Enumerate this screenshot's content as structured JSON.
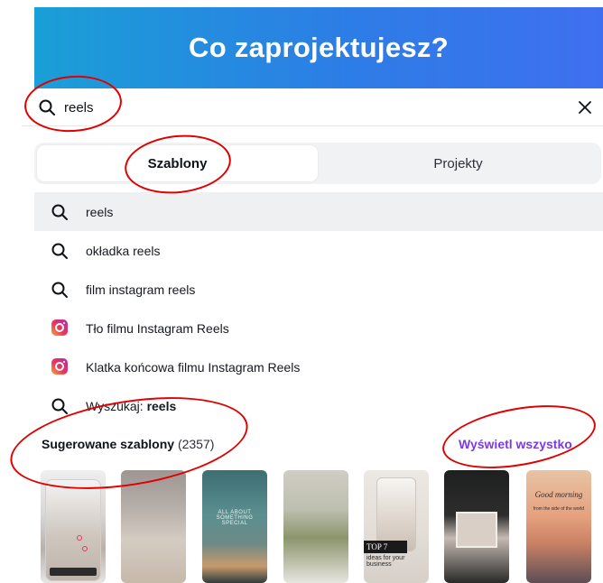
{
  "header": {
    "title": "Co zaprojektujesz?"
  },
  "search": {
    "value": "reels",
    "placeholder": ""
  },
  "tabs": [
    {
      "label": "Szablony",
      "active": true
    },
    {
      "label": "Projekty",
      "active": false
    }
  ],
  "suggestions": [
    {
      "text": "reels",
      "icon": "search-icon"
    },
    {
      "text": "okładka reels",
      "icon": "search-icon"
    },
    {
      "text": "film instagram reels",
      "icon": "search-icon"
    },
    {
      "text": "Tło filmu Instagram Reels",
      "icon": "instagram-icon"
    },
    {
      "text": "Klatka końcowa filmu Instagram Reels",
      "icon": "instagram-icon"
    },
    {
      "prefix": "Wyszukaj: ",
      "bold": "reels",
      "icon": "search-icon"
    }
  ],
  "templates_section": {
    "title": "Sugerowane szablony",
    "count": "(2357)",
    "view_all_label": "Wyświetl wszystko",
    "thumb3_caption": "ALL ABOUT\nSOMETHING\nSPECIAL",
    "thumb5_label": "TOP 7",
    "thumb5_sub": "ideas for your business",
    "thumb7_script": "Good morning",
    "thumb7_caption": "from the side of the world"
  },
  "colors": {
    "header_start": "#1a9fd6",
    "header_end": "#3f6ff0",
    "link_purple": "#7c3ae6",
    "annotation_red": "#e00000",
    "highlight_gray": "#eff0f2"
  }
}
